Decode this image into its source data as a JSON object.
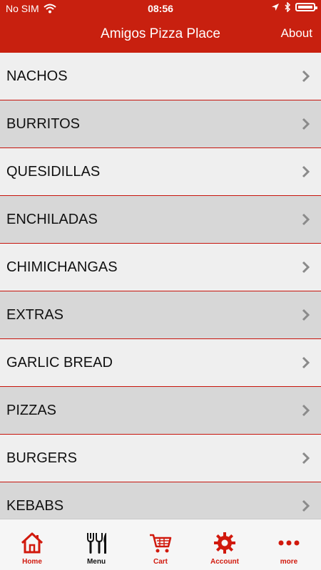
{
  "status_bar": {
    "carrier": "No SIM",
    "time": "08:56",
    "wifi_icon": "wifi-icon",
    "location_icon": "location-arrow-icon",
    "bluetooth_icon": "bluetooth-icon",
    "battery_icon": "battery-icon"
  },
  "nav": {
    "title": "Amigos Pizza Place",
    "about_label": "About"
  },
  "menu": {
    "items": [
      {
        "label": "NACHOS"
      },
      {
        "label": "BURRITOS"
      },
      {
        "label": "QUESIDILLAS"
      },
      {
        "label": "ENCHILADAS"
      },
      {
        "label": "CHIMICHANGAS"
      },
      {
        "label": "EXTRAS"
      },
      {
        "label": "GARLIC BREAD"
      },
      {
        "label": "PIZZAS"
      },
      {
        "label": "BURGERS"
      },
      {
        "label": "KEBABS"
      }
    ]
  },
  "tabbar": {
    "tabs": [
      {
        "label": "Home",
        "icon": "home-icon"
      },
      {
        "label": "Menu",
        "icon": "fork-knife-icon"
      },
      {
        "label": "Cart",
        "icon": "cart-icon"
      },
      {
        "label": "Account",
        "icon": "gear-icon"
      },
      {
        "label": "more",
        "icon": "more-dots-icon"
      }
    ]
  },
  "colors": {
    "brand_red": "#c8200f",
    "row_light": "#efefef",
    "row_dark": "#d7d7d7",
    "separator": "#c7140c",
    "tab_active": "#111111",
    "tab_inactive": "#d1190d"
  }
}
